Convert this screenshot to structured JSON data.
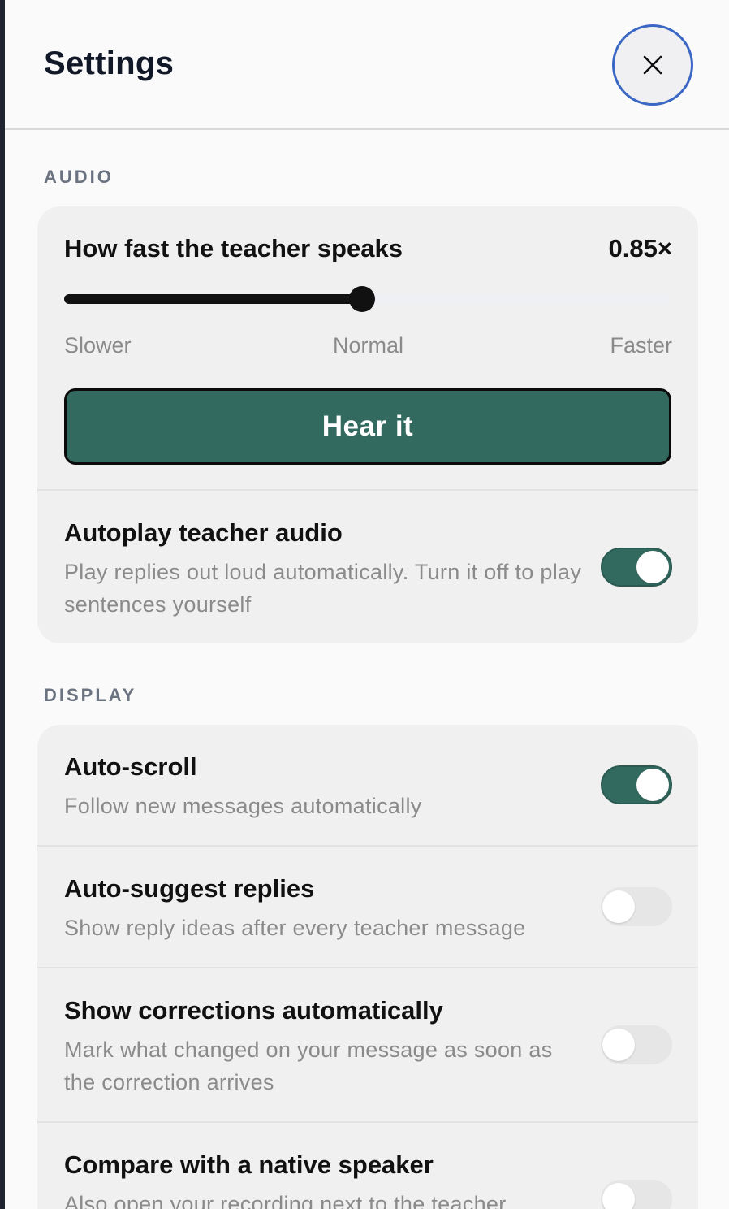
{
  "header": {
    "title": "Settings",
    "close_icon": "close-icon"
  },
  "colors": {
    "accent": "#336a60",
    "focus_ring": "#3a67c4"
  },
  "audio": {
    "section_label": "AUDIO",
    "speed": {
      "title": "How fast the teacher speaks",
      "value": "0.85×",
      "slider_fraction": 0.49,
      "labels": {
        "slower": "Slower",
        "normal": "Normal",
        "faster": "Faster"
      }
    },
    "hear_button": "Hear it",
    "autoplay": {
      "title": "Autoplay teacher audio",
      "description": "Play replies out loud automatically. Turn it off to play sentences yourself",
      "enabled": true
    }
  },
  "display": {
    "section_label": "DISPLAY",
    "auto_scroll": {
      "title": "Auto-scroll",
      "description": "Follow new messages automatically",
      "enabled": true
    },
    "auto_suggest": {
      "title": "Auto-suggest replies",
      "description": "Show reply ideas after every teacher message",
      "enabled": false
    },
    "corrections": {
      "title": "Show corrections automatically",
      "description": "Mark what changed on your message as soon as the correction arrives",
      "enabled": false
    },
    "compare": {
      "title": "Compare with a native speaker",
      "description": "Also open your recording next to the teacher",
      "enabled": false
    }
  }
}
